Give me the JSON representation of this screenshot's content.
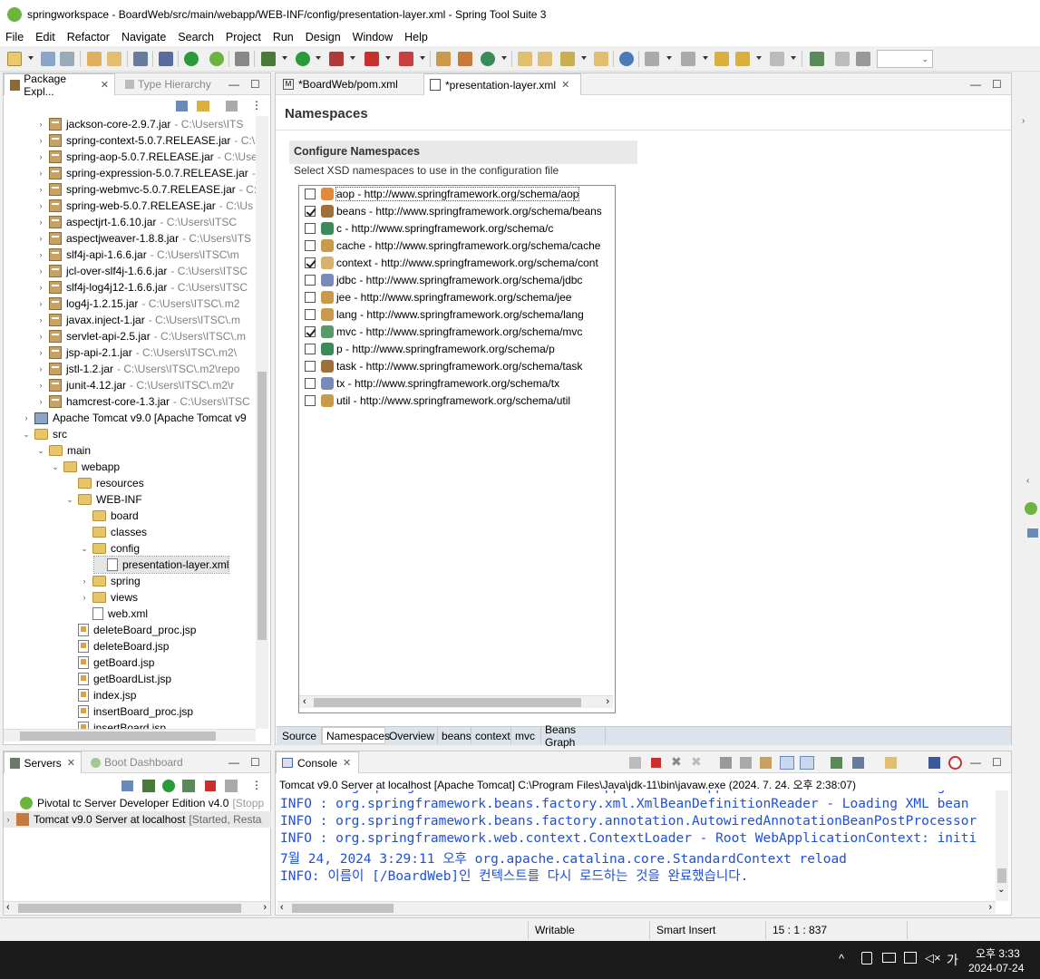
{
  "window": {
    "title": "springworkspace - BoardWeb/src/main/webapp/WEB-INF/config/presentation-layer.xml - Spring Tool Suite 3"
  },
  "menu": [
    "File",
    "Edit",
    "Refactor",
    "Navigate",
    "Search",
    "Project",
    "Run",
    "Design",
    "Window",
    "Help"
  ],
  "package_explorer": {
    "tab_active": "Package Expl...",
    "tab_inactive": "Type Hierarchy",
    "jars": [
      {
        "name": "jackson-core-2.9.7.jar",
        "path": "- C:\\Users\\ITS"
      },
      {
        "name": "spring-context-5.0.7.RELEASE.jar",
        "path": "- C:\\"
      },
      {
        "name": "spring-aop-5.0.7.RELEASE.jar",
        "path": "- C:\\Use"
      },
      {
        "name": "spring-expression-5.0.7.RELEASE.jar",
        "path": "-"
      },
      {
        "name": "spring-webmvc-5.0.7.RELEASE.jar",
        "path": "- C:"
      },
      {
        "name": "spring-web-5.0.7.RELEASE.jar",
        "path": "- C:\\Us"
      },
      {
        "name": "aspectjrt-1.6.10.jar",
        "path": "- C:\\Users\\ITSC"
      },
      {
        "name": "aspectjweaver-1.8.8.jar",
        "path": "- C:\\Users\\ITS"
      },
      {
        "name": "slf4j-api-1.6.6.jar",
        "path": "- C:\\Users\\ITSC\\m"
      },
      {
        "name": "jcl-over-slf4j-1.6.6.jar",
        "path": "- C:\\Users\\ITSC"
      },
      {
        "name": "slf4j-log4j12-1.6.6.jar",
        "path": "- C:\\Users\\ITSC"
      },
      {
        "name": "log4j-1.2.15.jar",
        "path": "- C:\\Users\\ITSC\\.m2"
      },
      {
        "name": "javax.inject-1.jar",
        "path": "- C:\\Users\\ITSC\\.m"
      },
      {
        "name": "servlet-api-2.5.jar",
        "path": "- C:\\Users\\ITSC\\.m"
      },
      {
        "name": "jsp-api-2.1.jar",
        "path": "- C:\\Users\\ITSC\\.m2\\"
      },
      {
        "name": "jstl-1.2.jar",
        "path": "- C:\\Users\\ITSC\\.m2\\repo"
      },
      {
        "name": "junit-4.12.jar",
        "path": "- C:\\Users\\ITSC\\.m2\\r"
      },
      {
        "name": "hamcrest-core-1.3.jar",
        "path": "- C:\\Users\\ITSC"
      }
    ],
    "tomcat_lib": "Apache Tomcat v9.0 [Apache Tomcat v9",
    "nodes": {
      "src": "src",
      "main": "main",
      "webapp": "webapp",
      "resources": "resources",
      "webinf": "WEB-INF",
      "board": "board",
      "classes": "classes",
      "config": "config",
      "presentation": "presentation-layer.xml",
      "spring": "spring",
      "views": "views",
      "webxml": "web.xml"
    },
    "jsps": [
      "deleteBoard_proc.jsp",
      "deleteBoard.jsp",
      "getBoard.jsp",
      "getBoardList.jsp",
      "index.jsp",
      "insertBoard_proc.jsp",
      "insertBoard.jsp"
    ]
  },
  "editor": {
    "tabs": [
      "*BoardWeb/pom.xml",
      "*presentation-layer.xml"
    ],
    "heading": "Namespaces",
    "section_title": "Configure Namespaces",
    "section_desc": "Select XSD namespaces to use in the configuration file",
    "namespaces": [
      {
        "label": "aop - http://www.springframework.org/schema/aop",
        "checked": false,
        "color": "#e08a3a"
      },
      {
        "label": "beans - http://www.springframework.org/schema/beans",
        "checked": true,
        "color": "#a0703a"
      },
      {
        "label": "c - http://www.springframework.org/schema/c",
        "checked": false,
        "color": "#3a8a5a"
      },
      {
        "label": "cache - http://www.springframework.org/schema/cache",
        "checked": false,
        "color": "#c89a4a"
      },
      {
        "label": "context - http://www.springframework.org/schema/cont",
        "checked": true,
        "color": "#d8b070"
      },
      {
        "label": "jdbc - http://www.springframework.org/schema/jdbc",
        "checked": false,
        "color": "#7a8ab8"
      },
      {
        "label": "jee - http://www.springframework.org/schema/jee",
        "checked": false,
        "color": "#c89a4a"
      },
      {
        "label": "lang - http://www.springframework.org/schema/lang",
        "checked": false,
        "color": "#c89a4a"
      },
      {
        "label": "mvc - http://www.springframework.org/schema/mvc",
        "checked": true,
        "color": "#5a9a6a"
      },
      {
        "label": "p - http://www.springframework.org/schema/p",
        "checked": false,
        "color": "#3a8a5a"
      },
      {
        "label": "task - http://www.springframework.org/schema/task",
        "checked": false,
        "color": "#a0703a"
      },
      {
        "label": "tx - http://www.springframework.org/schema/tx",
        "checked": false,
        "color": "#7a8ab8"
      },
      {
        "label": "util - http://www.springframework.org/schema/util",
        "checked": false,
        "color": "#c89a4a"
      }
    ],
    "bottom_tabs": [
      "Source",
      "Namespaces",
      "Overview",
      "beans",
      "context",
      "mvc",
      "Beans Graph"
    ],
    "bottom_active": "Namespaces"
  },
  "servers": {
    "tab_active": "Servers",
    "tab_inactive": "Boot Dashboard",
    "items": [
      {
        "name": "Pivotal tc Server Developer Edition v4.0",
        "status": "[Stopp"
      },
      {
        "name": "Tomcat v9.0 Server at localhost",
        "status": "[Started, Resta"
      }
    ]
  },
  "console": {
    "tab": "Console",
    "header": "Tomcat v9.0 Server at localhost [Apache Tomcat] C:\\Program Files\\Java\\jdk-11\\bin\\javaw.exe  (2024. 7. 24. 오후 2:38:07)",
    "lines": [
      "INFO : org.springframework.web.context.support.XmlWebApplicationContext - Refreshing Roo",
      "INFO : org.springframework.beans.factory.xml.XmlBeanDefinitionReader - Loading XML bean",
      "INFO : org.springframework.beans.factory.annotation.AutowiredAnnotationBeanPostProcessor",
      "INFO : org.springframework.web.context.ContextLoader - Root WebApplicationContext: initi",
      "7월 24, 2024 3:29:11 오후 org.apache.catalina.core.StandardContext reload",
      "INFO: 이름이 [/BoardWeb]인 컨텍스트를 다시 로드하는 것을 완료했습니다."
    ]
  },
  "status": {
    "writable": "Writable",
    "insert_mode": "Smart Insert",
    "position": "15 : 1 : 837"
  },
  "taskbar": {
    "time": "오후 3:33",
    "date": "2024-07-24",
    "ime": "가"
  }
}
